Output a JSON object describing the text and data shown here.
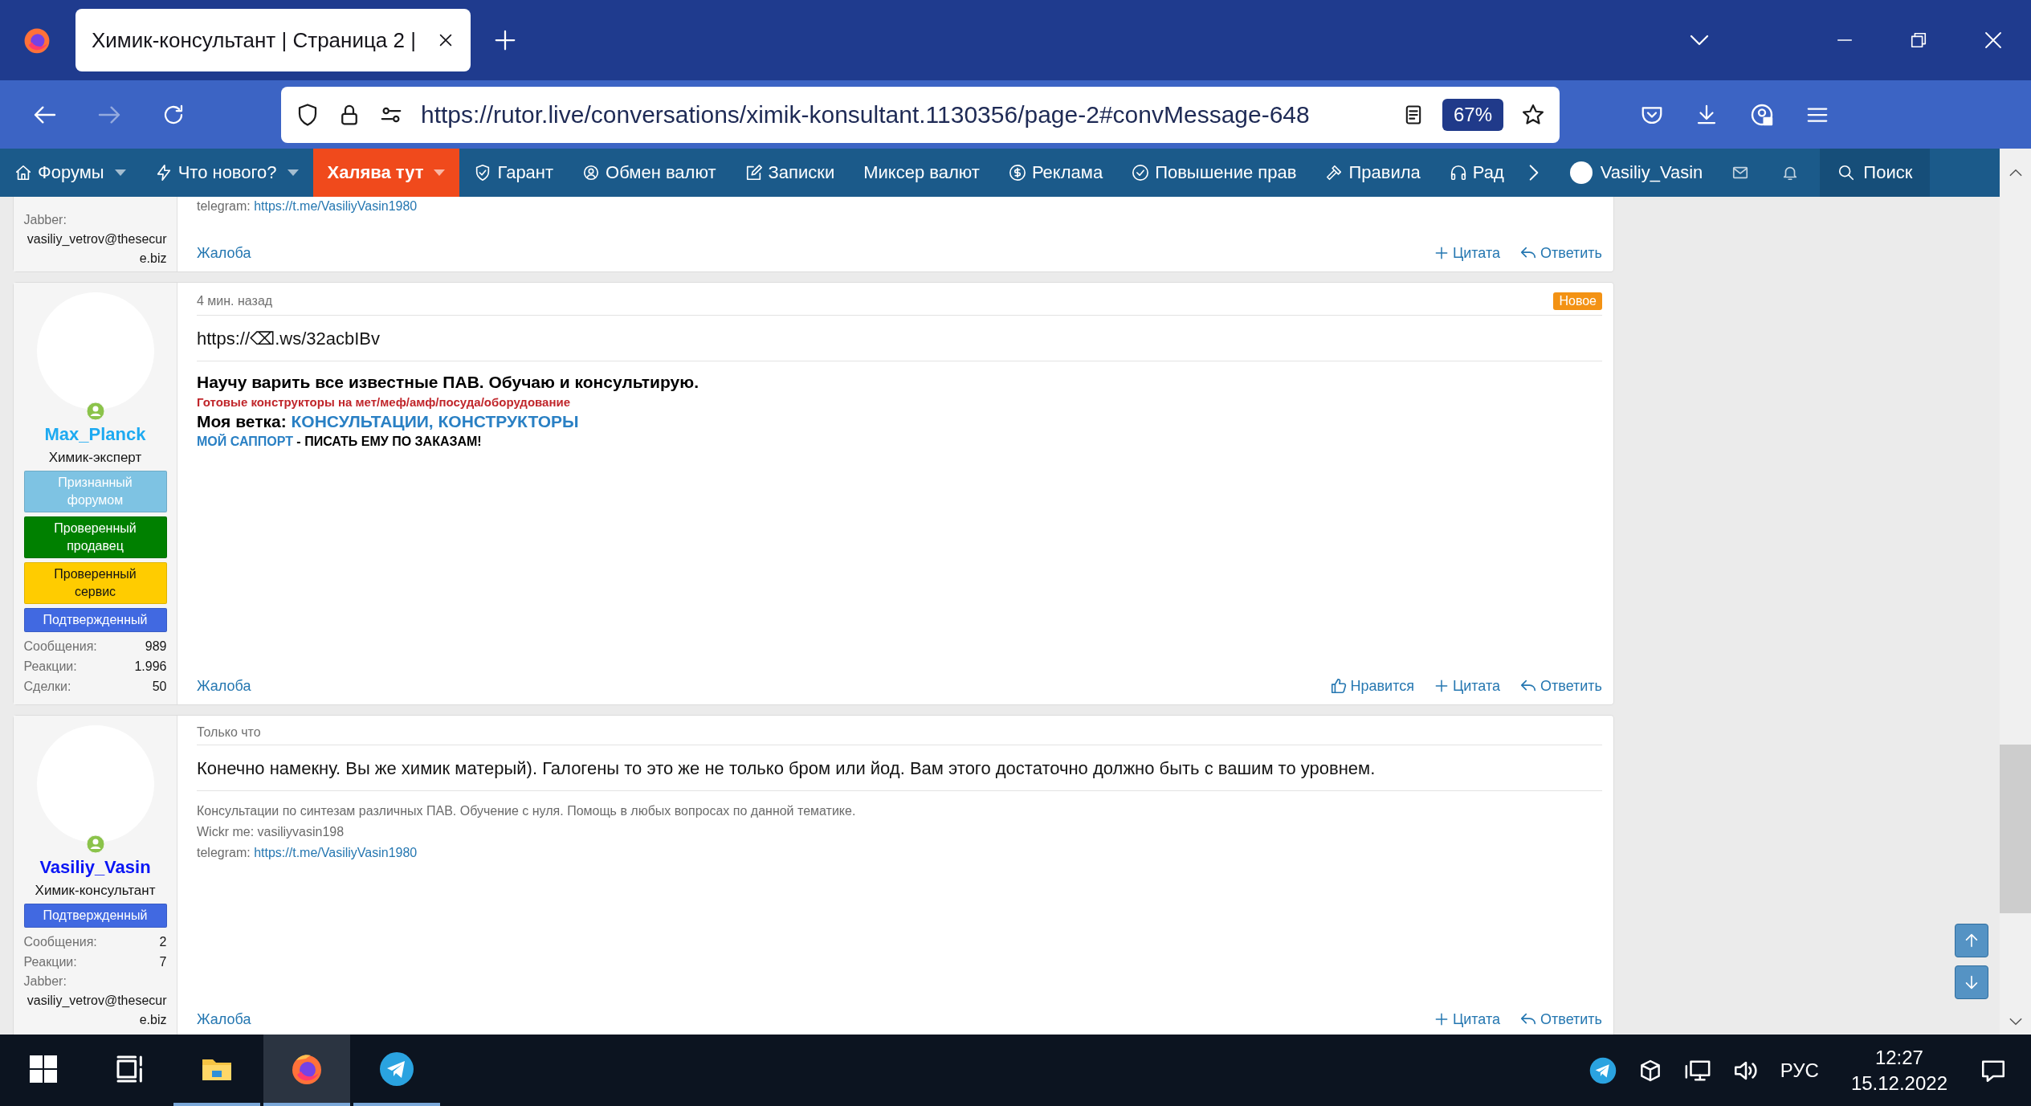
{
  "browser": {
    "tabs": [
      {
        "title": "Химик-консультант | Страница 2 |",
        "selected": true
      }
    ],
    "url": "https://rutor.live/conversations/ximik-konsultant.1130356/page-2#convMessage-648",
    "zoom": "67%"
  },
  "forum_nav": {
    "items": [
      {
        "label": "Форумы",
        "dropdown": true,
        "highlighted": false
      },
      {
        "label": "Что нового?",
        "dropdown": true,
        "highlighted": false
      },
      {
        "label": "Халява тут",
        "dropdown": true,
        "highlighted": true
      },
      {
        "label": "Гарант",
        "dropdown": false,
        "highlighted": false
      },
      {
        "label": "Обмен валют",
        "dropdown": false,
        "highlighted": false
      },
      {
        "label": "Записки",
        "dropdown": false,
        "highlighted": false
      },
      {
        "label": "Миксер валют",
        "dropdown": false,
        "highlighted": false
      },
      {
        "label": "Реклама",
        "dropdown": false,
        "highlighted": false
      },
      {
        "label": "Повышение прав",
        "dropdown": false,
        "highlighted": false
      },
      {
        "label": "Правила",
        "dropdown": false,
        "highlighted": false
      },
      {
        "label": "Рад",
        "dropdown": false,
        "highlighted": false
      }
    ],
    "user": "Vasiliy_Vasin",
    "search": "Поиск"
  },
  "posts": [
    {
      "author": {
        "contact": {
          "label": "Jabber:",
          "value": "vasiliy_vetrov@thesecure.biz"
        }
      },
      "signature": [
        {
          "kind": "contact",
          "text": "telegram:",
          "link": "https://t.me/VasiliyVasin1980"
        }
      ],
      "actions": [
        {
          "kind": "report",
          "label": "Жалоба"
        },
        {
          "kind": "quote",
          "label": "Цитата"
        },
        {
          "kind": "reply",
          "label": "Ответить"
        }
      ]
    },
    {
      "author": {
        "name": "Max_Planck",
        "color": "#1eaaf1",
        "title": "Химик-эксперт",
        "online": true,
        "badges": [
          {
            "label": "Признанный форумом",
            "color": "#7ec3e3"
          },
          {
            "label": "Проверенный продавец",
            "color": "#008000"
          },
          {
            "label": "Проверенный сервис",
            "color": "#ffcc00"
          },
          {
            "label": "Подтвержденный",
            "color": "#4169e1"
          }
        ],
        "stats": [
          {
            "label": "Сообщения:",
            "value": "989"
          },
          {
            "label": "Реакции:",
            "value": "1.996"
          },
          {
            "label": "Сделки:",
            "value": "50"
          }
        ]
      },
      "time": "4 мин. назад",
      "new_label": "Новое",
      "body": "https://⌫.ws/32acbIBv",
      "signature": [
        {
          "kind": "headline",
          "text": "Научу варить все известные ПАВ. Обучаю и консультирую."
        },
        {
          "kind": "alert",
          "text": "Готовые конструкторы на мет/меф/амф/посуда/оборудование"
        },
        {
          "kind": "branch",
          "text": "Моя ветка:",
          "link": "КОНСУЛЬТАЦИИ, КОНСТРУКТОРЫ"
        },
        {
          "kind": "support",
          "link": "МОЙ САППОРТ",
          "text": "- ПИСАТЬ ЕМУ ПО ЗАКАЗАМ!"
        }
      ],
      "actions": [
        {
          "kind": "report",
          "label": "Жалоба"
        },
        {
          "kind": "like",
          "label": "Нравится"
        },
        {
          "kind": "quote",
          "label": "Цитата"
        },
        {
          "kind": "reply",
          "label": "Ответить"
        }
      ]
    },
    {
      "author": {
        "name": "Vasiliy_Vasin",
        "color": "#0a16f5",
        "title": "Химик-консультант",
        "online": true,
        "badges": [
          {
            "label": "Подтвержденный",
            "color": "#4169e1"
          }
        ],
        "stats": [
          {
            "label": "Сообщения:",
            "value": "2"
          },
          {
            "label": "Реакции:",
            "value": "7"
          }
        ],
        "contact": {
          "label": "Jabber:",
          "value": "vasiliy_vetrov@thesecure.biz"
        }
      },
      "time": "Только что",
      "body": "Конечно намекну. Вы же химик матерый). Галогены то это же не только бром или йод. Вам этого достаточно должно быть с вашим то уровнем.",
      "signature": [
        {
          "kind": "plain",
          "text": "Консультации по синтезам различных ПАВ. Обучение с нуля. Помощь в любых вопросах по данной тематике."
        },
        {
          "kind": "plain",
          "text": "Wickr me: vasiliyvasin198"
        },
        {
          "kind": "contact",
          "text": "telegram:",
          "link": "https://t.me/VasiliyVasin1980"
        }
      ],
      "actions": [
        {
          "kind": "report",
          "label": "Жалоба"
        },
        {
          "kind": "quote",
          "label": "Цитата"
        },
        {
          "kind": "reply",
          "label": "Ответить"
        }
      ]
    }
  ],
  "taskbar": {
    "apps": [
      {
        "kind": "explorer",
        "selected": false
      },
      {
        "kind": "browser",
        "selected": true
      },
      {
        "kind": "messenger",
        "selected": false
      }
    ],
    "language": "РУС",
    "time": "12:27",
    "date": "15.12.2022"
  }
}
